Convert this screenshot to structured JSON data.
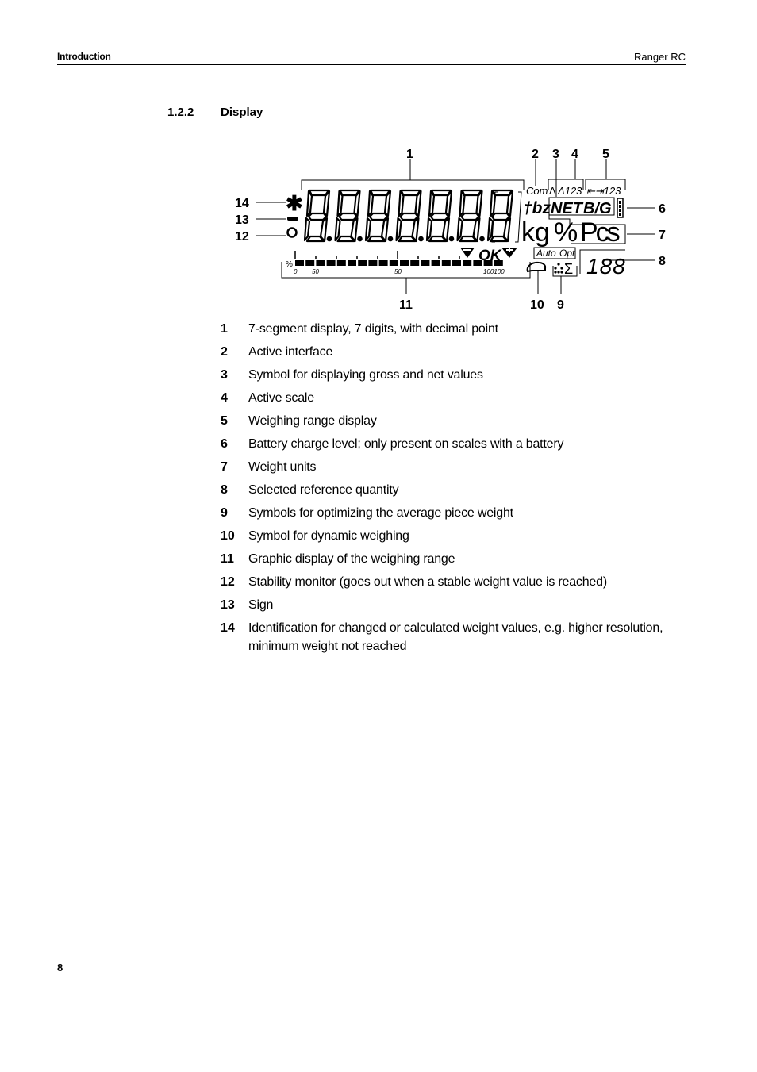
{
  "header": {
    "section": "Introduction",
    "product": "Ranger RC"
  },
  "section": {
    "number": "1.2.2",
    "title": "Display"
  },
  "diagram": {
    "callouts": [
      "1",
      "2",
      "3",
      "4",
      "5",
      "6",
      "7",
      "8",
      "9",
      "10",
      "11",
      "12",
      "13",
      "14"
    ],
    "digits": "8888888",
    "labels": {
      "com": "Com",
      "delta_net": "Δ",
      "delta_scale": "Δ123",
      "range": "⇤⇥123",
      "tbz": "†bz",
      "net": "NET",
      "bg": "B/G",
      "kg": "kg",
      "percent": "%",
      "pcs": "Pcs",
      "auto": "Auto",
      "opt": "Opt",
      "sigma": "Σ",
      "ref_qty": "188",
      "ok": "OK",
      "bar_percent": "%",
      "bar_ticks": [
        "0",
        "50",
        "50",
        "100100"
      ],
      "asterisk": "✱"
    }
  },
  "legend": [
    {
      "num": "1",
      "text": "7-segment display, 7 digits, with decimal point"
    },
    {
      "num": "2",
      "text": "Active interface"
    },
    {
      "num": "3",
      "text": "Symbol for displaying gross and net values"
    },
    {
      "num": "4",
      "text": "Active scale"
    },
    {
      "num": "5",
      "text": "Weighing range display"
    },
    {
      "num": "6",
      "text": "Battery charge level; only present on scales with a battery"
    },
    {
      "num": "7",
      "text": "Weight units"
    },
    {
      "num": "8",
      "text": "Selected reference quantity"
    },
    {
      "num": "9",
      "text": "Symbols for optimizing the average piece weight"
    },
    {
      "num": "10",
      "text": "Symbol for dynamic weighing"
    },
    {
      "num": "11",
      "text": "Graphic display of the weighing range"
    },
    {
      "num": "12",
      "text": "Stability monitor (goes out when a stable weight value is reached)"
    },
    {
      "num": "13",
      "text": "Sign"
    },
    {
      "num": "14",
      "text": "Identification for changed or calculated weight values, e.g. higher resolution, minimum weight not reached"
    }
  ],
  "footer": {
    "page_number": "8"
  }
}
